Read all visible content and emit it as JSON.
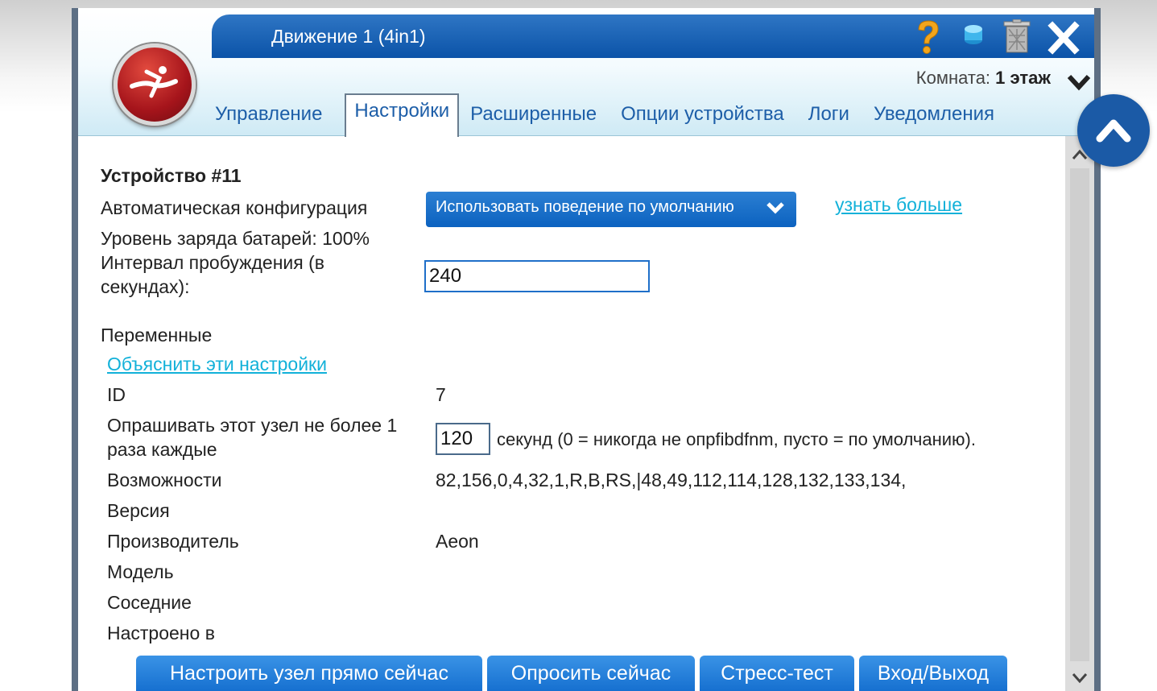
{
  "window": {
    "title": "Движение 1 (4in1)",
    "room_label": "Комната:",
    "room_value": "1 этаж"
  },
  "tabs": [
    {
      "label": "Управление",
      "active": false
    },
    {
      "label": "Настройки",
      "active": true
    },
    {
      "label": "Расширенные",
      "active": false
    },
    {
      "label": "Опции устройства",
      "active": false
    },
    {
      "label": "Логи",
      "active": false
    },
    {
      "label": "Уведомления",
      "active": false
    }
  ],
  "device": {
    "heading": "Устройство #11",
    "auto_config_label": "Автоматическая конфигурация",
    "auto_config_value": "Использовать поведение по умолчанию",
    "learn_more": "узнать больше",
    "battery": "Уровень заряда батарей: 100%",
    "wakeup_label_line1": "Интервал пробуждения (в",
    "wakeup_label_line2": "секундах):",
    "wakeup_value": "240"
  },
  "variables": {
    "heading": "Переменные",
    "explain_link": "Объяснить эти настройки",
    "id_label": "ID",
    "id_value": "7",
    "poll_label_line1": "Опрашивать этот узел не более 1",
    "poll_label_line2": "раза каждые",
    "poll_value": "120",
    "poll_suffix": "секунд (0 = никогда не опрfibdfnm, пусто = по умолчанию).",
    "capabilities_label": "Возможности",
    "capabilities_value": "82,156,0,4,32,1,R,B,RS,|48,49,112,114,128,132,133,134,",
    "version_label": "Версия",
    "manufacturer_label": "Производитель",
    "manufacturer_value": "Aeon",
    "model_label": "Модель",
    "neighbors_label": "Соседние",
    "configured_label": "Настроено в"
  },
  "buttons": {
    "configure": "Настроить узел прямо сейчас",
    "poll": "Опросить сейчас",
    "stress": "Стресс-тест",
    "inout": "Вход/Выход"
  },
  "colors": {
    "accent_blue": "#1670d0",
    "link": "#12b1d9",
    "title_bar": "#0b53a8"
  }
}
